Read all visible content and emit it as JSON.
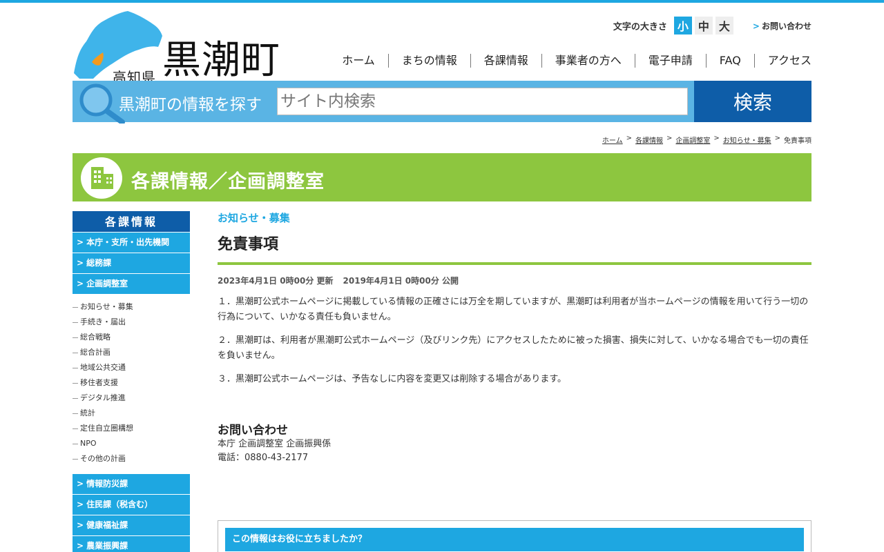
{
  "header": {
    "prefecture": "高知県",
    "town": "黒潮町",
    "font_size_label": "文字の大きさ",
    "font_sizes": [
      "小",
      "中",
      "大"
    ],
    "contact": "お問い合わせ",
    "nav": [
      "ホーム",
      "まちの情報",
      "各課情報",
      "事業者の方へ",
      "電子申請",
      "FAQ",
      "アクセス"
    ]
  },
  "search": {
    "label": "黒潮町の情報を探す",
    "placeholder": "サイト内検索",
    "button": "検索"
  },
  "breadcrumb": [
    "ホーム",
    "各課情報",
    "企画調整室",
    "お知らせ・募集",
    "免責事項"
  ],
  "section": {
    "title": "各課情報／企画調整室"
  },
  "sidebar": {
    "heading": "各課情報",
    "top_items": [
      "本庁・支所・出先機関",
      "総務課",
      "企画調整室"
    ],
    "sub_items": [
      "お知らせ・募集",
      "手続き・届出",
      "総合戦略",
      "総合計画",
      "地域公共交通",
      "移住者支援",
      "デジタル推進",
      "統計",
      "定住自立圏構想",
      "NPO",
      "その他の計画"
    ],
    "bottom_items": [
      "情報防災課",
      "住民課（税含む）",
      "健康福祉課",
      "農業振興課"
    ]
  },
  "article": {
    "category": "お知らせ・募集",
    "title": "免責事項",
    "updated": "2023年4月1日 0時00分 更新",
    "published": "2019年4月1日 0時00分 公開",
    "paragraphs": [
      "１．黒潮町公式ホームページに掲載している情報の正確さには万全を期していますが、黒潮町は利用者が当ホームページの情報を用いて行う一切の行為について、いかなる責任も負いません。",
      "２．黒潮町は、利用者が黒潮町公式ホームページ（及びリンク先）にアクセスしたために被った損害、損失に対して、いかなる場合でも一切の責任を負いません。",
      "３．黒潮町公式ホームページは、予告なしに内容を変更又は削除する場合があります。"
    ]
  },
  "inquiry": {
    "heading": "お問い合わせ",
    "dept": "本庁 企画調整室 企画振興係",
    "phone": "電話：0880-43-2177"
  },
  "survey": {
    "title": "この情報はお役に立ちましたか？"
  },
  "colors": {
    "accent_blue": "#1ea7e1",
    "dark_blue": "#0e5da8",
    "green": "#8dc63f"
  },
  "icons": [
    "kochi-map-logo",
    "magnifier-icon",
    "building-icon",
    "chevron-right-icon"
  ]
}
